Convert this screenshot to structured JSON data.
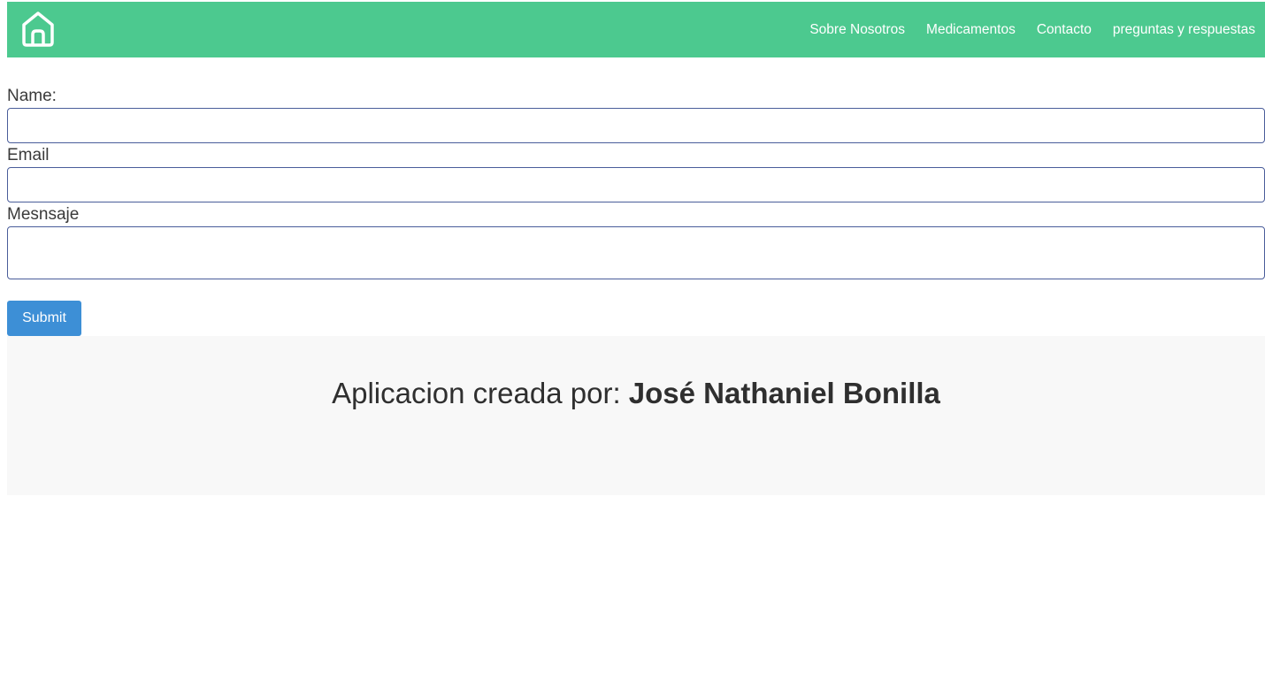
{
  "navbar": {
    "background_color": "#4cc98f",
    "home_icon": "home-icon",
    "links": [
      "Sobre Nosotros",
      "Medicamentos",
      "Contacto",
      "preguntas y respuestas"
    ]
  },
  "form": {
    "name_label": "Name:",
    "name_value": "",
    "email_label": "Email",
    "email_value": "",
    "message_label": "Mesnsaje",
    "message_value": "",
    "submit_label": "Submit",
    "submit_color": "#3d8fd6"
  },
  "footer": {
    "prefix": "Aplicacion creada por:",
    "author": "José Nathaniel Bonilla"
  }
}
